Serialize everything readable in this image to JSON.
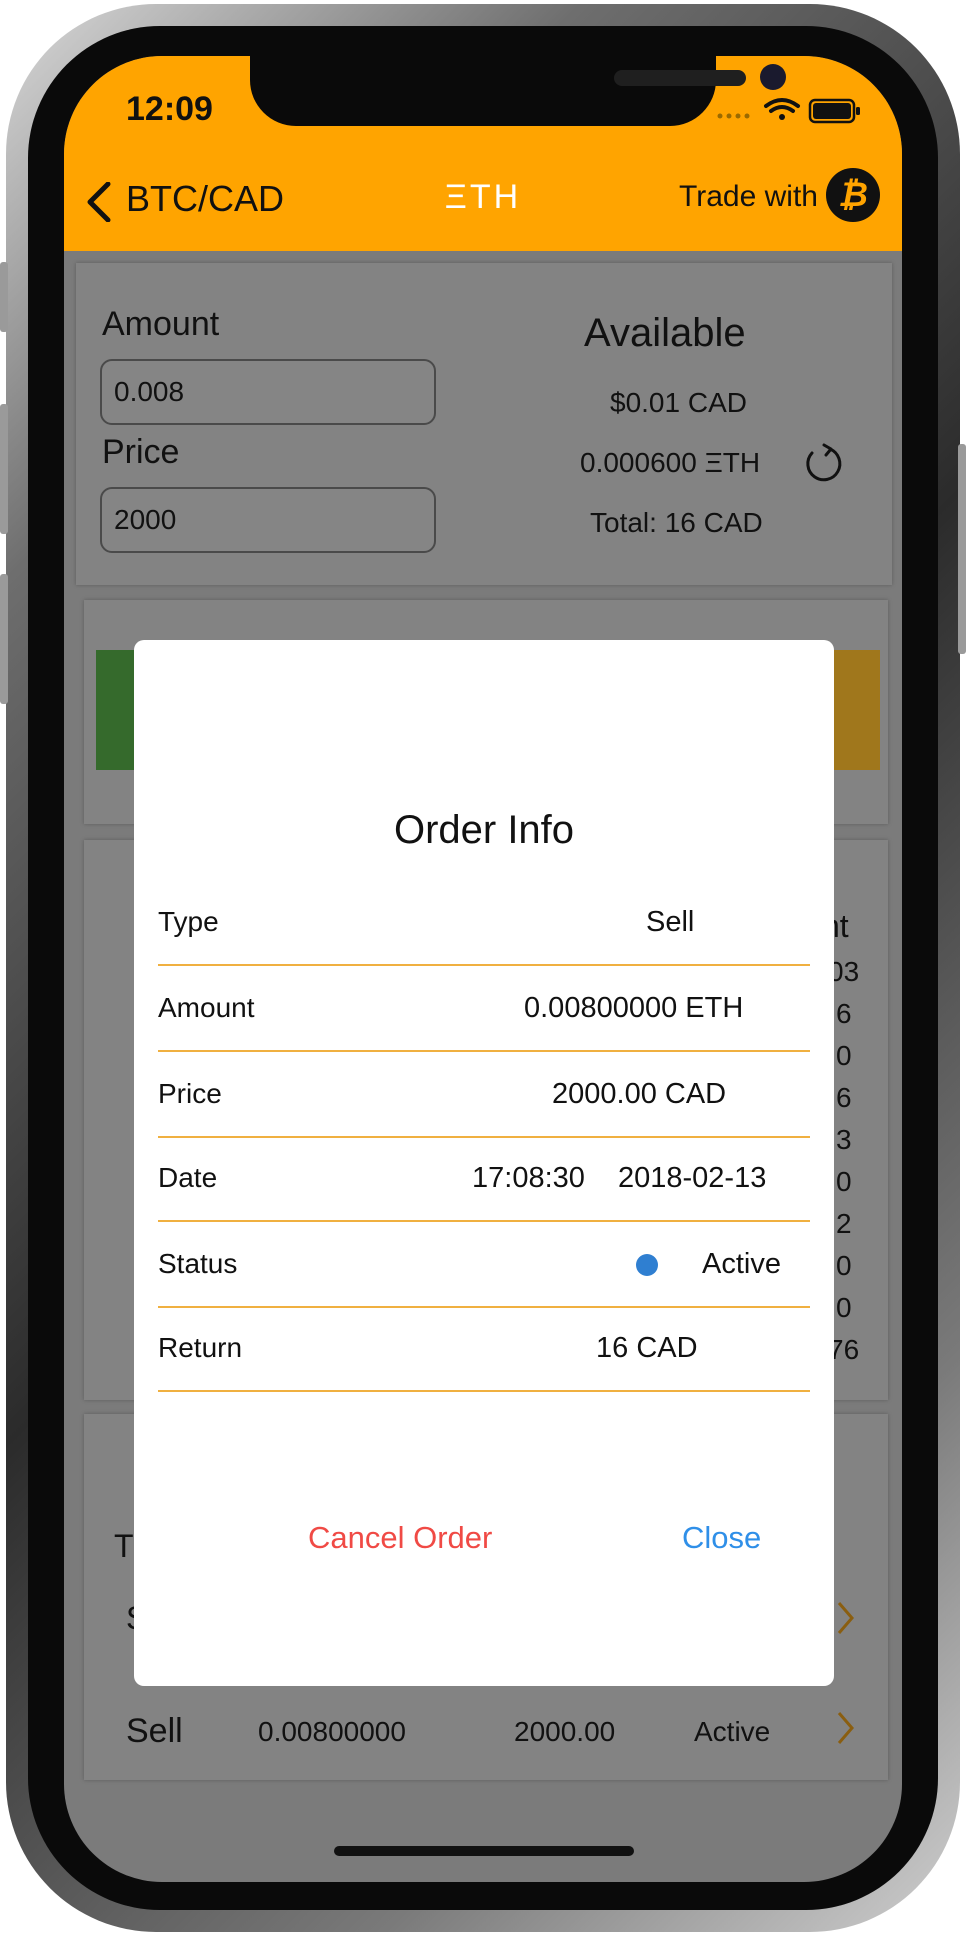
{
  "status_bar": {
    "time": "12:09"
  },
  "nav": {
    "back_label": "BTC/CAD",
    "title": "ΞTH",
    "trade_with_label": "Trade with",
    "trade_coin_symbol": "₿"
  },
  "form": {
    "amount_label": "Amount",
    "amount_value": "0.008",
    "price_label": "Price",
    "price_value": "2000"
  },
  "available": {
    "title": "Available",
    "cad": "$0.01 CAD",
    "eth": "0.000600 ΞTH",
    "total": "Total: 16 CAD"
  },
  "background_partial": {
    "column_header_fragment": "nt",
    "amount_fragments": [
      "03",
      "6",
      "0",
      "6",
      "3",
      "0",
      "2",
      "0",
      "0",
      "76"
    ],
    "section_letter": "T",
    "row_letter": "S"
  },
  "orders": [
    {
      "type": "Sell",
      "amount": "0.00800000",
      "price": "2000.00",
      "status": "Active"
    }
  ],
  "modal": {
    "title": "Order Info",
    "rows": [
      {
        "key": "Type",
        "value": "Sell"
      },
      {
        "key": "Amount",
        "value": "0.00800000 ETH"
      },
      {
        "key": "Price",
        "value": "2000.00 CAD"
      },
      {
        "key": "Date",
        "time": "17:08:30",
        "date": "2018-02-13"
      },
      {
        "key": "Status",
        "value": "Active"
      },
      {
        "key": "Return",
        "value": "16 CAD"
      }
    ],
    "cancel_label": "Cancel Order",
    "close_label": "Close"
  },
  "colors": {
    "header_bg": "#ffa400",
    "cancel": "#f04a45",
    "close": "#2f8fe8",
    "status_active": "#2f7fd1",
    "row_divider": "#f0b040",
    "buy_strip": "#356a2c",
    "sell_strip": "#a0771c"
  }
}
